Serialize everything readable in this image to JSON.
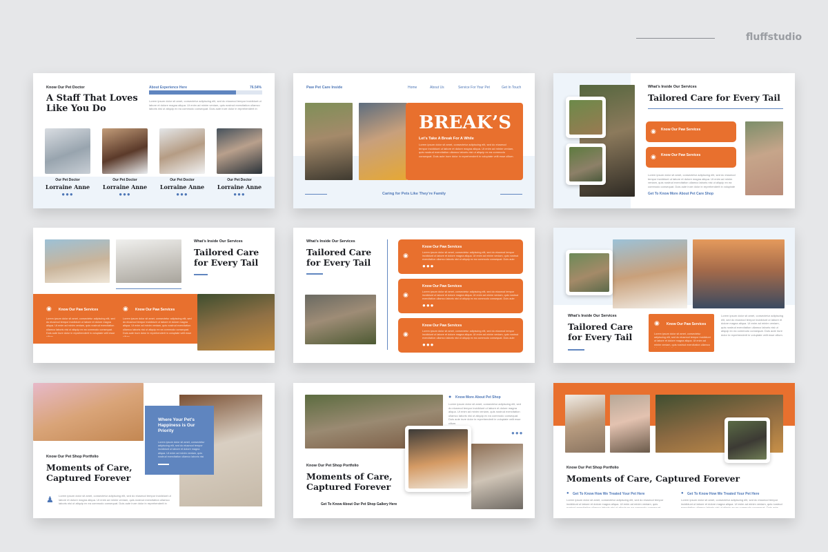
{
  "brand": {
    "name": "fluffstudio"
  },
  "colors": {
    "orange": "#e8702e",
    "blue": "#5f85bf",
    "pale_blue": "#eef4fa",
    "dark": "#1b1d22"
  },
  "lorem": {
    "line": "Lorem ipsum dolor sit amet, consectetur adipiscing elit, sed do eiusmod tempor incididunt ut labore et dolore magna aliqua. Ut enim ad minim veniam, quis nostrud exercitation ullamco laboris nisi ut aliquip ex ea commodo consequat. Duis aute irure dolor in reprehenderit in voluptate velit esse cillum."
  },
  "slides": [
    {
      "kicker": "Know Our Pet Doctor",
      "title": "A Staff That Loves Like You Do",
      "progress_label": "About Experience Here",
      "progress_value": "76.54%",
      "progress_fraction": 0.7654,
      "doctors": [
        {
          "role": "Our Pet Doctor",
          "name": "Lorraine Anne",
          "dots": "●●●"
        },
        {
          "role": "Our Pet Doctor",
          "name": "Lorraine Anne",
          "dots": "●●●"
        },
        {
          "role": "Our Pet Doctor",
          "name": "Lorraine Anne",
          "dots": "●●●"
        },
        {
          "role": "Our Pet Doctor",
          "name": "Lorraine Anne",
          "dots": "●●●"
        }
      ]
    },
    {
      "site_title": "Paw Pet Care Inside",
      "nav": [
        "Home",
        "About Us",
        "Service For Your Pet",
        "Get In Touch"
      ],
      "title": "BREAK’S",
      "subtitle": "Let’s Take A Break For A While",
      "footer": "Caring for Pets Like They’re Family"
    },
    {
      "kicker": "What’s Inside Our Services",
      "title": "Tailored Care for Every Tail",
      "cards": [
        "Know Our Paw Services",
        "Know Our Paw Services"
      ],
      "link": "Get To Know More About Pet Care Shop"
    },
    {
      "kicker": "What’s Inside Our Services",
      "title": "Tailored Care for Every Tail",
      "cards": [
        "Know Our Paw Services",
        "Know Our Paw Services"
      ]
    },
    {
      "kicker": "What’s Inside Our Services",
      "title": "Tailored Care for Every Tail",
      "cards": [
        "Know Our Paw Services",
        "Know Our Paw Services",
        "Know Our Paw Services"
      ],
      "dots": "●●●"
    },
    {
      "kicker": "What’s Inside Our Services",
      "title": "Tailored Care for Every Tail",
      "card": "Know Our Paw Services"
    },
    {
      "box_text": "Where Your Pet’s Happiness is Our Priority",
      "kicker": "Know Our Pet Shop Portfolio",
      "title": "Moments of Care, Captured Forever"
    },
    {
      "link_top": "Know More About Pet Shop",
      "dots": "●●●",
      "kicker": "Know Our Pet Shop Portfolio",
      "title": "Moments of Care, Captured Forever",
      "link_bottom": "Get To Know About Our Pet Shop Gallery Here"
    },
    {
      "kicker": "Know Our Pet Shop Portfolio",
      "title": "Moments of Care, Captured Forever",
      "links": [
        "Get To Know How We Treated Your Pet Here",
        "Get To Know How We Treated Your Pet Here"
      ]
    }
  ]
}
